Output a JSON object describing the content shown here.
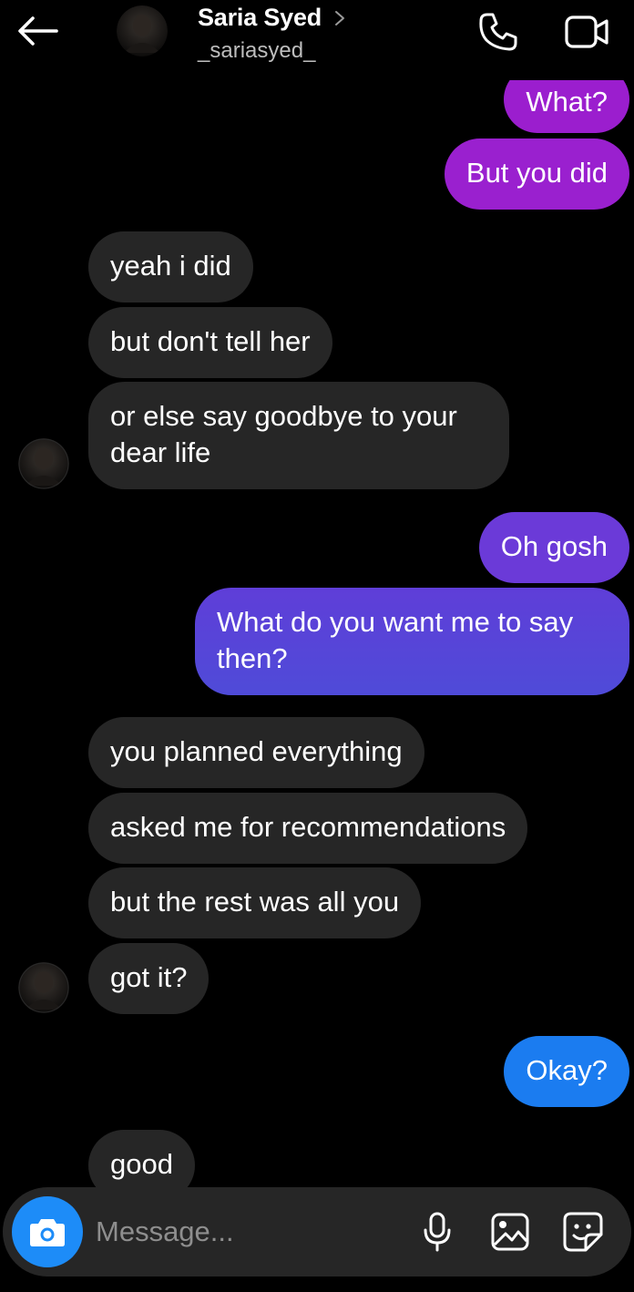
{
  "header": {
    "contact_name": "Saria Syed",
    "username": "_sariasyed_"
  },
  "icons": {
    "back": "arrow-left-icon",
    "chevron": "chevron-right-icon",
    "call": "phone-icon",
    "video": "video-camera-icon",
    "camera": "camera-icon",
    "mic": "microphone-icon",
    "gallery": "image-icon",
    "sticker": "sticker-icon"
  },
  "colors": {
    "received_bubble": "#262626",
    "sent_gradient_top": "#9c1fcf",
    "sent_gradient_mid": "#5a3fd6",
    "sent_gradient_bottom": "#1b7cf0",
    "camera_button": "#1d8cf8",
    "background": "#000000"
  },
  "messages": [
    {
      "from": "me",
      "text": "What?"
    },
    {
      "from": "me",
      "text": "But you did"
    },
    {
      "from": "them",
      "text": "yeah i did"
    },
    {
      "from": "them",
      "text": "but don't tell her"
    },
    {
      "from": "them",
      "text": "or else say goodbye to your dear life"
    },
    {
      "from": "me",
      "text": "Oh gosh"
    },
    {
      "from": "me",
      "text": "What do you want me to say then?"
    },
    {
      "from": "them",
      "text": "you planned everything"
    },
    {
      "from": "them",
      "text": "asked me for recommendations"
    },
    {
      "from": "them",
      "text": "but the rest was all you"
    },
    {
      "from": "them",
      "text": "got it?"
    },
    {
      "from": "me",
      "text": "Okay?"
    },
    {
      "from": "them",
      "text": "good"
    }
  ],
  "composer": {
    "placeholder": "Message..."
  }
}
